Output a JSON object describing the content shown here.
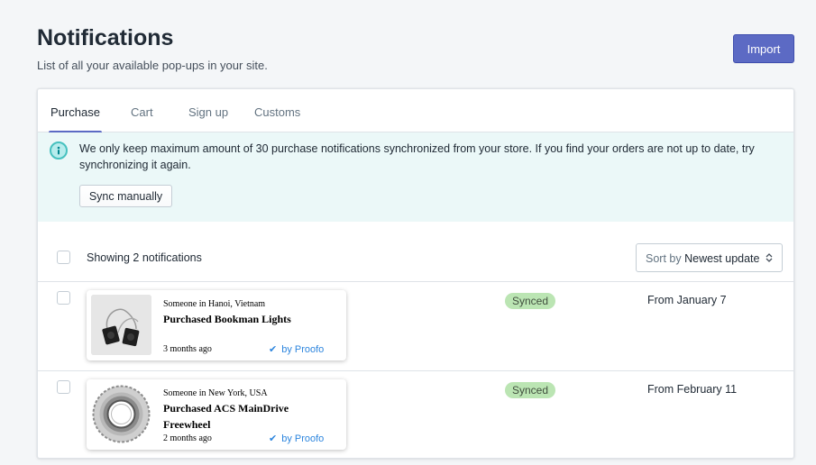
{
  "page": {
    "title": "Notifications",
    "subtitle": "List of all your available pop-ups in your site.",
    "import_label": "Import"
  },
  "tabs": [
    {
      "label": "Purchase",
      "active": true
    },
    {
      "label": "Cart",
      "active": false
    },
    {
      "label": "Sign up",
      "active": false
    },
    {
      "label": "Customs",
      "active": false
    }
  ],
  "banner": {
    "text": "We only keep maximum amount of 30 purchase notifications synchronized from your store. If you find your orders are not up to date, try synchronizing it again.",
    "sync_label": "Sync manually",
    "icon": "info-icon",
    "accent_color": "#47c1bf"
  },
  "list": {
    "showing_text": "Showing 2 notifications",
    "sort_prefix": "Sort by",
    "sort_value": "Newest update"
  },
  "notifications": [
    {
      "who": "Someone in Hanoi, Vietnam",
      "what": "Purchased Bookman Lights",
      "time": "3 months ago",
      "by": "by Proofo",
      "status": "Synced",
      "from": "From January 7"
    },
    {
      "who": "Someone in New York, USA",
      "what": "Purchased ACS MainDrive Freewheel",
      "time": "2 months ago",
      "by": "by Proofo",
      "status": "Synced",
      "from": "From February 11"
    }
  ],
  "colors": {
    "primary": "#5c6ac4",
    "synced_badge": "#bbe5b3",
    "banner_bg": "#ebf8f8",
    "link_blue": "#2e86de"
  }
}
